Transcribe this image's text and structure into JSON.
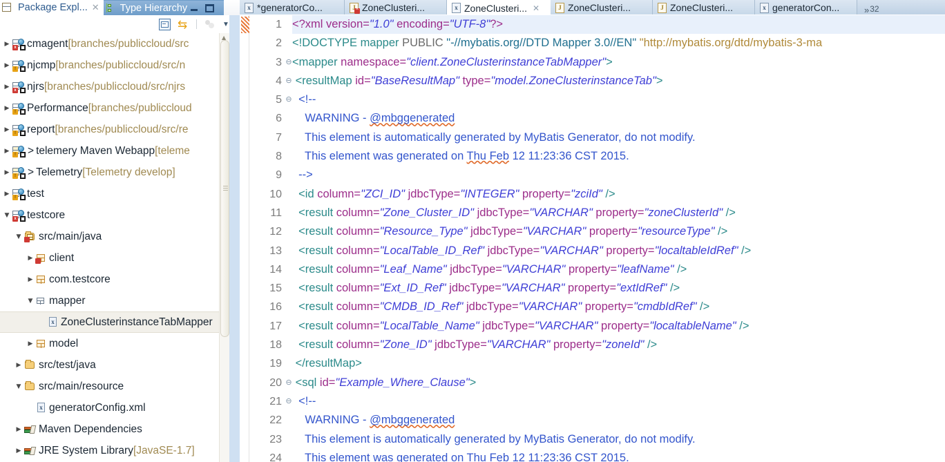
{
  "left_view": {
    "tabs": [
      {
        "label": "Package Expl...",
        "icon": "package-explorer-icon",
        "active": true,
        "closable": true
      },
      {
        "label": "Type Hierarchy",
        "icon": "type-hierarchy-icon",
        "active": false,
        "closable": false
      }
    ],
    "window_buttons": [
      "minimize",
      "maximize"
    ],
    "toolbar": [
      {
        "name": "collapse-all-icon",
        "tooltip": "Collapse All"
      },
      {
        "name": "link-with-editor-icon",
        "tooltip": "Link with Editor"
      },
      {
        "name": "view-menu-icon",
        "tooltip": "View Menu"
      }
    ],
    "tree": [
      {
        "indent": 0,
        "arrow": "collapsed",
        "icon": "java-project-icon",
        "badge": "error",
        "name": "cmagent",
        "path": "[branches/publiccloud/src"
      },
      {
        "indent": 0,
        "arrow": "collapsed",
        "icon": "java-project-icon",
        "badge": "warning",
        "name": "njcmp",
        "path": "[branches/publiccloud/src/n"
      },
      {
        "indent": 0,
        "arrow": "collapsed",
        "icon": "java-project-icon",
        "badge": "error",
        "name": "njrs",
        "path": "[branches/publiccloud/src/njrs"
      },
      {
        "indent": 0,
        "arrow": "collapsed",
        "icon": "java-project-icon",
        "badge": "warning",
        "name": "Performance",
        "path": "[branches/publiccloud"
      },
      {
        "indent": 0,
        "arrow": "collapsed",
        "icon": "java-project-icon",
        "badge": "warning",
        "name": "report",
        "path": "[branches/publiccloud/src/re"
      },
      {
        "indent": 0,
        "arrow": "collapsed",
        "icon": "web-project-icon",
        "badge": "warning",
        "gt": ">",
        "name": "telemery Maven Webapp",
        "path": "[teleme"
      },
      {
        "indent": 0,
        "arrow": "collapsed",
        "icon": "web-project-icon",
        "badge": "warning",
        "gt": ">",
        "name": "Telemetry",
        "path": "[Telemetry develop]"
      },
      {
        "indent": 0,
        "arrow": "collapsed",
        "icon": "java-project-icon",
        "badge": "warning",
        "name": "test",
        "path": ""
      },
      {
        "indent": 0,
        "arrow": "expanded",
        "icon": "java-project-icon",
        "badge": "error",
        "name": "testcore",
        "path": ""
      },
      {
        "indent": 1,
        "arrow": "expanded",
        "icon": "source-folder-icon",
        "badge": "error",
        "name": "src/main/java",
        "path": ""
      },
      {
        "indent": 2,
        "arrow": "collapsed",
        "icon": "package-icon",
        "badge": "error",
        "name": "client",
        "path": ""
      },
      {
        "indent": 2,
        "arrow": "collapsed",
        "icon": "package-icon",
        "badge": "none",
        "name": "com.testcore",
        "path": ""
      },
      {
        "indent": 2,
        "arrow": "expanded",
        "icon": "package-empty-icon",
        "badge": "none",
        "name": "mapper",
        "path": ""
      },
      {
        "indent": 3,
        "arrow": "none",
        "icon": "xml-file-icon",
        "badge": "none",
        "name": "ZoneClusterinstanceTabMapper",
        "path": "",
        "selected": true
      },
      {
        "indent": 2,
        "arrow": "collapsed",
        "icon": "package-icon",
        "badge": "none",
        "name": "model",
        "path": ""
      },
      {
        "indent": 1,
        "arrow": "collapsed",
        "icon": "source-folder-plain-icon",
        "badge": "none",
        "name": "src/test/java",
        "path": ""
      },
      {
        "indent": 1,
        "arrow": "expanded",
        "icon": "source-folder-plain-icon",
        "badge": "none",
        "name": "src/main/resource",
        "path": ""
      },
      {
        "indent": 2,
        "arrow": "none",
        "icon": "xml-file-icon",
        "badge": "none",
        "name": "generatorConfig.xml",
        "path": ""
      },
      {
        "indent": 1,
        "arrow": "collapsed",
        "icon": "library-icon",
        "badge": "none",
        "name": "Maven Dependencies",
        "path": ""
      },
      {
        "indent": 1,
        "arrow": "collapsed",
        "icon": "library-icon",
        "badge": "none",
        "name": "JRE System Library ",
        "path": "[JavaSE-1.7]"
      }
    ],
    "scrollbar": {
      "name": "tree-vertical-scrollbar"
    }
  },
  "editor": {
    "tabs": [
      {
        "label": "*generatorCo...",
        "icon": "xml-file-icon",
        "active": false,
        "dirty": true,
        "closable": false
      },
      {
        "label": "ZoneClusteri...",
        "icon": "java-file-error-icon",
        "active": false,
        "dirty": false,
        "closable": false
      },
      {
        "label": "ZoneClusteri...",
        "icon": "xml-file-icon",
        "active": true,
        "dirty": false,
        "closable": true
      },
      {
        "label": "ZoneClusteri...",
        "icon": "java-file-icon",
        "active": false,
        "dirty": false,
        "closable": false
      },
      {
        "label": "ZoneClusteri...",
        "icon": "java-file-icon",
        "active": false,
        "dirty": false,
        "closable": false
      },
      {
        "label": "generatorCon...",
        "icon": "xml-file-icon",
        "active": false,
        "dirty": false,
        "closable": false
      }
    ],
    "more_tabs": {
      "chevron": "»",
      "count": "32"
    },
    "marker_bar": {
      "name": "overview-marker",
      "color": "#e8793a"
    },
    "lines": [
      {
        "n": "1",
        "fold": "",
        "highlight": true,
        "parts": [
          {
            "t": "<?xml version=",
            "c": "pi"
          },
          {
            "t": "\"1.0\"",
            "c": "val"
          },
          {
            "t": " encoding=",
            "c": "pi"
          },
          {
            "t": "\"UTF-8\"",
            "c": "val"
          },
          {
            "t": "?>",
            "c": "pi"
          }
        ]
      },
      {
        "n": "2",
        "fold": "",
        "parts": [
          {
            "t": "<!DOCTYPE mapper ",
            "c": "dtd"
          },
          {
            "t": "PUBLIC ",
            "c": "dtdkw"
          },
          {
            "t": "\"-//mybatis.org//DTD Mapper 3.0//EN\" ",
            "c": "dtdq"
          },
          {
            "t": "\"http://mybatis.org/dtd/mybatis-3-ma",
            "c": "dturl"
          }
        ]
      },
      {
        "n": "3",
        "fold": "⊖",
        "parts": [
          {
            "t": "<mapper ",
            "c": "tag"
          },
          {
            "t": "namespace=",
            "c": "attr"
          },
          {
            "t": "\"client.ZoneClusterinstanceTabMapper\"",
            "c": "val"
          },
          {
            "t": ">",
            "c": "tag"
          }
        ]
      },
      {
        "n": "4",
        "fold": "⊖",
        "parts": [
          {
            "t": " <resultMap ",
            "c": "tag"
          },
          {
            "t": "id=",
            "c": "attr"
          },
          {
            "t": "\"BaseResultMap\"",
            "c": "val"
          },
          {
            "t": " ",
            "c": "tag"
          },
          {
            "t": "type=",
            "c": "attr"
          },
          {
            "t": "\"model.ZoneClusterinstanceTab\"",
            "c": "val"
          },
          {
            "t": ">",
            "c": "tag"
          }
        ]
      },
      {
        "n": "5",
        "fold": "⊖",
        "parts": [
          {
            "t": "  <!--",
            "c": "cmt"
          }
        ]
      },
      {
        "n": "6",
        "fold": "",
        "parts": [
          {
            "t": "    WARNING - ",
            "c": "cmt"
          },
          {
            "t": "@mbggenerated",
            "c": "cmt sq"
          }
        ]
      },
      {
        "n": "7",
        "fold": "",
        "parts": [
          {
            "t": "    This element is automatically generated by MyBatis Generator, do not modify.",
            "c": "cmt"
          }
        ]
      },
      {
        "n": "8",
        "fold": "",
        "parts": [
          {
            "t": "    This element was generated on ",
            "c": "cmt"
          },
          {
            "t": "Thu Feb",
            "c": "cmt sq"
          },
          {
            "t": " 12 11:23:36 CST 2015.",
            "c": "cmt"
          }
        ]
      },
      {
        "n": "9",
        "fold": "",
        "parts": [
          {
            "t": "  -->",
            "c": "cmt"
          }
        ]
      },
      {
        "n": "10",
        "fold": "",
        "parts": [
          {
            "t": "  <id ",
            "c": "tag"
          },
          {
            "t": "column=",
            "c": "attr"
          },
          {
            "t": "\"ZCI_ID\"",
            "c": "val"
          },
          {
            "t": " ",
            "c": "tag"
          },
          {
            "t": "jdbcType=",
            "c": "attr"
          },
          {
            "t": "\"INTEGER\"",
            "c": "val"
          },
          {
            "t": " ",
            "c": "tag"
          },
          {
            "t": "property=",
            "c": "attr"
          },
          {
            "t": "\"zciId\"",
            "c": "val"
          },
          {
            "t": " />",
            "c": "tag"
          }
        ]
      },
      {
        "n": "11",
        "fold": "",
        "parts": [
          {
            "t": "  <result ",
            "c": "tag"
          },
          {
            "t": "column=",
            "c": "attr"
          },
          {
            "t": "\"Zone_Cluster_ID\"",
            "c": "val"
          },
          {
            "t": " ",
            "c": "tag"
          },
          {
            "t": "jdbcType=",
            "c": "attr"
          },
          {
            "t": "\"VARCHAR\"",
            "c": "val"
          },
          {
            "t": " ",
            "c": "tag"
          },
          {
            "t": "property=",
            "c": "attr"
          },
          {
            "t": "\"zoneClusterId\"",
            "c": "val"
          },
          {
            "t": " />",
            "c": "tag"
          }
        ]
      },
      {
        "n": "12",
        "fold": "",
        "parts": [
          {
            "t": "  <result ",
            "c": "tag"
          },
          {
            "t": "column=",
            "c": "attr"
          },
          {
            "t": "\"Resource_Type\"",
            "c": "val"
          },
          {
            "t": " ",
            "c": "tag"
          },
          {
            "t": "jdbcType=",
            "c": "attr"
          },
          {
            "t": "\"VARCHAR\"",
            "c": "val"
          },
          {
            "t": " ",
            "c": "tag"
          },
          {
            "t": "property=",
            "c": "attr"
          },
          {
            "t": "\"resourceType\"",
            "c": "val"
          },
          {
            "t": " />",
            "c": "tag"
          }
        ]
      },
      {
        "n": "13",
        "fold": "",
        "parts": [
          {
            "t": "  <result ",
            "c": "tag"
          },
          {
            "t": "column=",
            "c": "attr"
          },
          {
            "t": "\"LocalTable_ID_Ref\"",
            "c": "val"
          },
          {
            "t": " ",
            "c": "tag"
          },
          {
            "t": "jdbcType=",
            "c": "attr"
          },
          {
            "t": "\"VARCHAR\"",
            "c": "val"
          },
          {
            "t": " ",
            "c": "tag"
          },
          {
            "t": "property=",
            "c": "attr"
          },
          {
            "t": "\"localtableIdRef\"",
            "c": "val"
          },
          {
            "t": " />",
            "c": "tag"
          }
        ]
      },
      {
        "n": "14",
        "fold": "",
        "parts": [
          {
            "t": "  <result ",
            "c": "tag"
          },
          {
            "t": "column=",
            "c": "attr"
          },
          {
            "t": "\"Leaf_Name\"",
            "c": "val"
          },
          {
            "t": " ",
            "c": "tag"
          },
          {
            "t": "jdbcType=",
            "c": "attr"
          },
          {
            "t": "\"VARCHAR\"",
            "c": "val"
          },
          {
            "t": " ",
            "c": "tag"
          },
          {
            "t": "property=",
            "c": "attr"
          },
          {
            "t": "\"leafName\"",
            "c": "val"
          },
          {
            "t": " />",
            "c": "tag"
          }
        ]
      },
      {
        "n": "15",
        "fold": "",
        "parts": [
          {
            "t": "  <result ",
            "c": "tag"
          },
          {
            "t": "column=",
            "c": "attr"
          },
          {
            "t": "\"Ext_ID_Ref\"",
            "c": "val"
          },
          {
            "t": " ",
            "c": "tag"
          },
          {
            "t": "jdbcType=",
            "c": "attr"
          },
          {
            "t": "\"VARCHAR\"",
            "c": "val"
          },
          {
            "t": " ",
            "c": "tag"
          },
          {
            "t": "property=",
            "c": "attr"
          },
          {
            "t": "\"extIdRef\"",
            "c": "val"
          },
          {
            "t": " />",
            "c": "tag"
          }
        ]
      },
      {
        "n": "16",
        "fold": "",
        "parts": [
          {
            "t": "  <result ",
            "c": "tag"
          },
          {
            "t": "column=",
            "c": "attr"
          },
          {
            "t": "\"CMDB_ID_Ref\"",
            "c": "val"
          },
          {
            "t": " ",
            "c": "tag"
          },
          {
            "t": "jdbcType=",
            "c": "attr"
          },
          {
            "t": "\"VARCHAR\"",
            "c": "val"
          },
          {
            "t": " ",
            "c": "tag"
          },
          {
            "t": "property=",
            "c": "attr"
          },
          {
            "t": "\"cmdbIdRef\"",
            "c": "val"
          },
          {
            "t": " />",
            "c": "tag"
          }
        ]
      },
      {
        "n": "17",
        "fold": "",
        "parts": [
          {
            "t": "  <result ",
            "c": "tag"
          },
          {
            "t": "column=",
            "c": "attr"
          },
          {
            "t": "\"LocalTable_Name\"",
            "c": "val"
          },
          {
            "t": " ",
            "c": "tag"
          },
          {
            "t": "jdbcType=",
            "c": "attr"
          },
          {
            "t": "\"VARCHAR\"",
            "c": "val"
          },
          {
            "t": " ",
            "c": "tag"
          },
          {
            "t": "property=",
            "c": "attr"
          },
          {
            "t": "\"localtableName\"",
            "c": "val"
          },
          {
            "t": " />",
            "c": "tag"
          }
        ]
      },
      {
        "n": "18",
        "fold": "",
        "parts": [
          {
            "t": "  <result ",
            "c": "tag"
          },
          {
            "t": "column=",
            "c": "attr"
          },
          {
            "t": "\"Zone_ID\"",
            "c": "val"
          },
          {
            "t": " ",
            "c": "tag"
          },
          {
            "t": "jdbcType=",
            "c": "attr"
          },
          {
            "t": "\"VARCHAR\"",
            "c": "val"
          },
          {
            "t": " ",
            "c": "tag"
          },
          {
            "t": "property=",
            "c": "attr"
          },
          {
            "t": "\"zoneId\"",
            "c": "val"
          },
          {
            "t": " />",
            "c": "tag"
          }
        ]
      },
      {
        "n": "19",
        "fold": "",
        "parts": [
          {
            "t": " </resultMap>",
            "c": "tag"
          }
        ]
      },
      {
        "n": "20",
        "fold": "⊖",
        "parts": [
          {
            "t": " <sql ",
            "c": "tag"
          },
          {
            "t": "id=",
            "c": "attr"
          },
          {
            "t": "\"Example_Where_Clause\"",
            "c": "val"
          },
          {
            "t": ">",
            "c": "tag"
          }
        ]
      },
      {
        "n": "21",
        "fold": "⊖",
        "parts": [
          {
            "t": "  <!--",
            "c": "cmt"
          }
        ]
      },
      {
        "n": "22",
        "fold": "",
        "parts": [
          {
            "t": "    WARNING - ",
            "c": "cmt"
          },
          {
            "t": "@mbggenerated",
            "c": "cmt sq"
          }
        ]
      },
      {
        "n": "23",
        "fold": "",
        "parts": [
          {
            "t": "    This element is automatically generated by MyBatis Generator, do not modify.",
            "c": "cmt"
          }
        ]
      },
      {
        "n": "24",
        "fold": "",
        "parts": [
          {
            "t": "    This element was generated on ",
            "c": "cmt"
          },
          {
            "t": "Thu Feb",
            "c": "cmt sq"
          },
          {
            "t": " 12 11:23:36 CST 2015.",
            "c": "cmt"
          }
        ]
      }
    ]
  },
  "colors": {
    "tag": "#2b8a8a",
    "attribute": "#9c2d8a",
    "value": "#3e3ed6",
    "comment": "#3355cc",
    "line_number": "#7b7b7b",
    "selection_line": "#e8f0fb",
    "tree_selection": "#f2f0ea",
    "tab_active": "#ffffff",
    "tabbar_gradient_top": "#d6e2ef",
    "tabbar_gradient_bottom": "#bdd0e4",
    "view_tab_selected": "#6e9dc9",
    "path_text": "#a08a52",
    "marker_orange": "#e8793a"
  }
}
